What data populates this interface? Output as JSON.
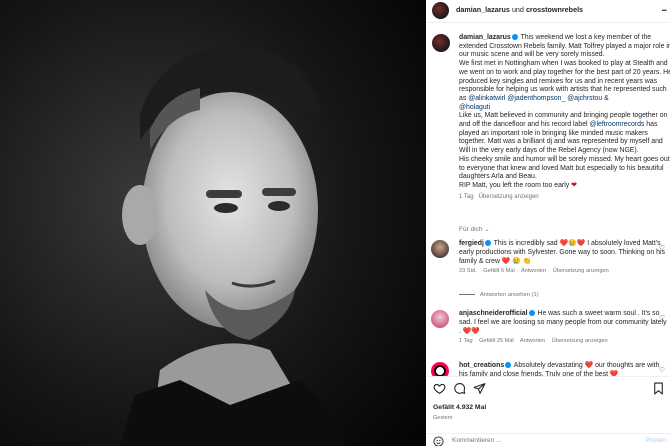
{
  "header": {
    "username": "damian_lazarus",
    "connector": "und",
    "collab": "crosstownrebels",
    "more": "..."
  },
  "caption": {
    "username": "damian_lazarus",
    "p1": " This weekend we lost a key member of the extended Crosstown Rebels family. Matt Tolfrey played a major role in our music scene and will be very sorely missed.\nWe first met in Nottingham when I was booked to play at Stealth and we went on to work and play together for the best part of 20 years. He produced key singles and remixes for us and in recent years was responsible for helping us work with artists that he represented such as ",
    "m1": "@alinkatwirl",
    "m2": "@jadenthompson_",
    "m3": "@ajchrstou",
    "amp": " &",
    "m4": "@holaguti",
    "p2": "\nLike us, Matt believed in community and bringing people together on and off the dancefloor and his record label ",
    "m5": "@leftroomrecords",
    "p3": " has played an important role in bringing like minded music makers together. Matt was a brilliant dj and was represented by myself and Will in the very early days of the Rebel Agency (now NGE).\nHis cheeky smile and humor will be sorely missed. My heart goes out to everyone that knew and loved Matt but especially to his beautiful daughters Arla and Beau.\nRIP Matt, you left the room too early ",
    "heart": "❤",
    "time": "1 Tag",
    "translate": "Übersetzung anzeigen"
  },
  "see_all": "Für dich ⌄",
  "comments": [
    {
      "username": "fergiedj",
      "text": " This is incredibly sad ❤️😢❤️ I absolutely loved Matt's early productions with Sylvester. Gone way to soon. Thinking on his family & crew ❤️ 😢 👏",
      "time": "23 Std.",
      "likes": "Gefällt 6 Mal",
      "reply": "Antworten",
      "translate": "Übersetzung anzeigen",
      "replies": "Antworten ansehen (1)"
    },
    {
      "username": "anjaschneiderofficial",
      "text": " He was such a sweet warm soul . It's so sad. I feel we are loosing so many people from our community lately . ❤️❤️",
      "time": "1 Tag",
      "likes": "Gefällt 25 Mal",
      "reply": "Antworten",
      "translate": "Übersetzung anzeigen"
    },
    {
      "username": "hot_creations",
      "text": " Absolutely devastating ❤️ our thoughts are with his family and close friends. Truly one of the best ❤️"
    }
  ],
  "footer": {
    "likes": "Gefällt 4.932 Mal",
    "date": "Gestern",
    "comment_placeholder": "Kommentieren ...",
    "post": "Posten"
  },
  "icons": [
    "heart-icon",
    "comment-icon",
    "share-icon",
    "bookmark-icon",
    "emoji-icon",
    "more-icon",
    "verified-icon"
  ],
  "colors": {
    "link": "#00376b",
    "verified": "#0095f6",
    "heart": "#c0111f",
    "muted": "#737373",
    "post": "#a6cffc"
  }
}
